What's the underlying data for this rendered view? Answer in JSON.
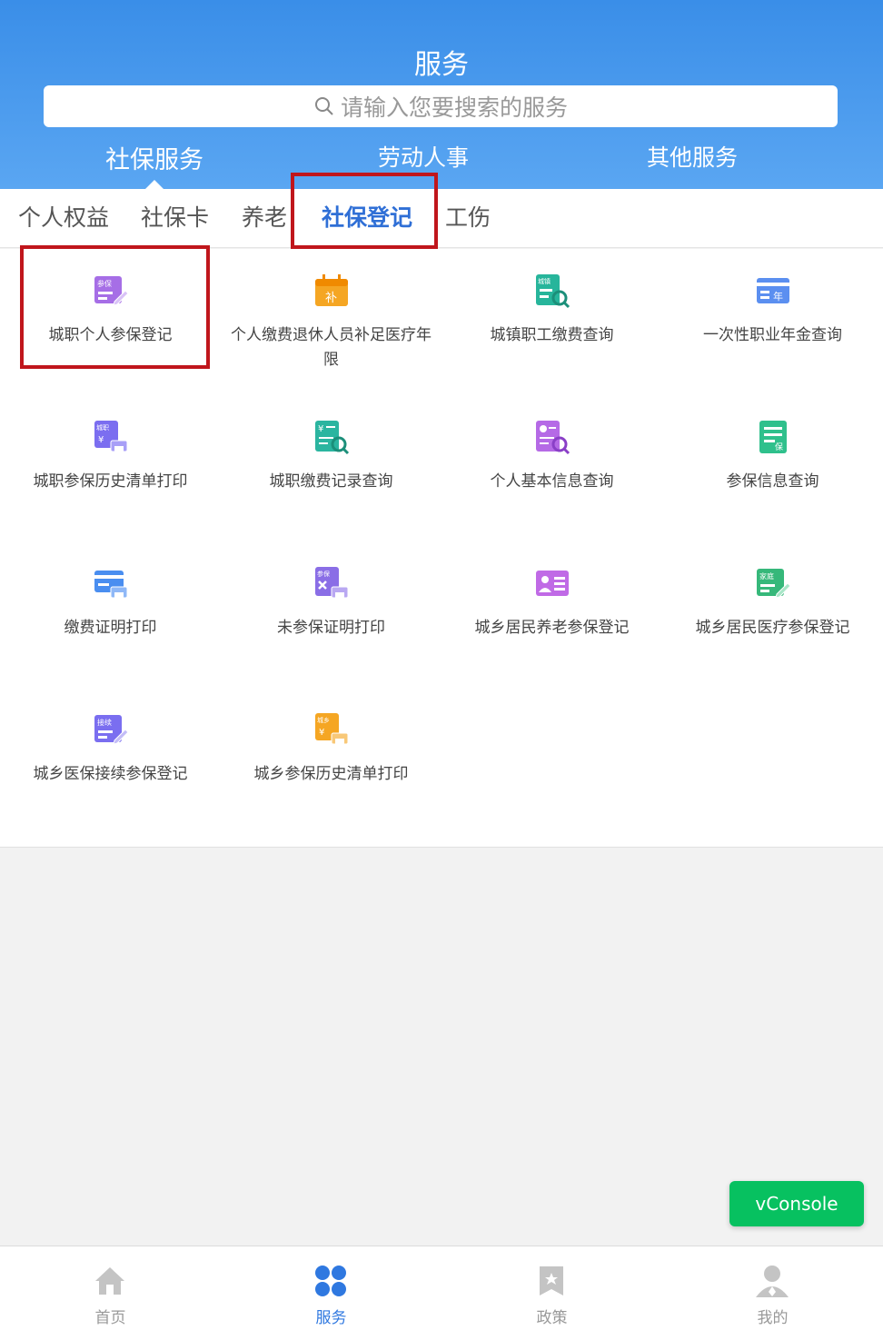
{
  "header": {
    "title": "服务",
    "search_placeholder": "请输入您要搜索的服务",
    "tabs": [
      {
        "label": "社保服务",
        "active": true
      },
      {
        "label": "劳动人事",
        "active": false
      },
      {
        "label": "其他服务",
        "active": false
      }
    ]
  },
  "subtabs": [
    {
      "label": "个人权益",
      "active": false
    },
    {
      "label": "社保卡",
      "active": false
    },
    {
      "label": "养老",
      "active": false
    },
    {
      "label": "社保登记",
      "active": true
    },
    {
      "label": "工伤",
      "active": false
    }
  ],
  "services": [
    {
      "label": "城职个人参保登记",
      "icon": "register-icon",
      "color": "#a66ee6"
    },
    {
      "label": "个人缴费退休人员补足医疗年限",
      "icon": "calendar-supplement-icon",
      "color": "#f5a623"
    },
    {
      "label": "城镇职工缴费查询",
      "icon": "doc-search-icon",
      "color": "#27b59b"
    },
    {
      "label": "一次性职业年金查询",
      "icon": "card-icon",
      "color": "#5b8ff0"
    },
    {
      "label": "城职参保历史清单打印",
      "icon": "print-icon",
      "color": "#7b6ef0"
    },
    {
      "label": "城职缴费记录查询",
      "icon": "fee-search-icon",
      "color": "#2bb5a0"
    },
    {
      "label": "个人基本信息查询",
      "icon": "profile-search-icon",
      "color": "#b56ae6"
    },
    {
      "label": "参保信息查询",
      "icon": "doc-icon",
      "color": "#2fc08c"
    },
    {
      "label": "缴费证明打印",
      "icon": "card-print-icon",
      "color": "#4a8ef0"
    },
    {
      "label": "未参保证明打印",
      "icon": "cert-print-icon",
      "color": "#8a6ee6"
    },
    {
      "label": "城乡居民养老参保登记",
      "icon": "person-list-icon",
      "color": "#c06ae6"
    },
    {
      "label": "城乡居民医疗参保登记",
      "icon": "family-register-icon",
      "color": "#36b87a"
    },
    {
      "label": "城乡医保接续参保登记",
      "icon": "transfer-register-icon",
      "color": "#7a6ef0"
    },
    {
      "label": "城乡参保历史清单打印",
      "icon": "history-print-icon",
      "color": "#f5a623"
    }
  ],
  "vconsole_label": "vConsole",
  "tabbar": [
    {
      "label": "首页",
      "icon": "home-icon",
      "active": false
    },
    {
      "label": "服务",
      "icon": "grid-icon",
      "active": true
    },
    {
      "label": "政策",
      "icon": "bookmark-icon",
      "active": false
    },
    {
      "label": "我的",
      "icon": "user-icon",
      "active": false
    }
  ],
  "colors": {
    "brand": "#3a8ee8",
    "active_text": "#2f6fd6",
    "highlight_box": "#c0161c",
    "vconsole": "#07c160"
  }
}
